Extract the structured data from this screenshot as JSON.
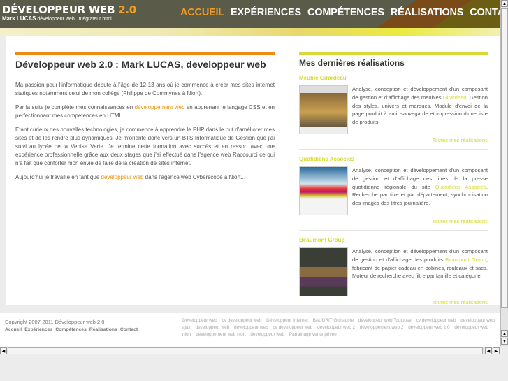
{
  "header": {
    "title": "DÉVELOPPEUR WEB",
    "version": "2.0",
    "author": "Mark LUCAS",
    "tagline": "développeur web, Intégrateur html"
  },
  "nav": [
    {
      "label": "ACCUEIL",
      "active": true
    },
    {
      "label": "EXPÉRIENCES"
    },
    {
      "label": "COMPÉTENCES"
    },
    {
      "label": "RÉALISATIONS"
    },
    {
      "label": "CONTACT"
    }
  ],
  "main": {
    "title": "Développeur web 2.0 : Mark LUCAS, developpeur web",
    "p1": "Ma passion pour l'informatique débute à l'âge de 12-13 ans où je commence à créer mes sites internet statiques notamment celui de mon collège (Philippe de Commynes à Niort).",
    "p2a": "Par la suite je complète mes connaissances en ",
    "p2link": "développement web",
    "p2b": " en apprenant le langage CSS et en perfectionnant mes compétences en HTML.",
    "p3": "Etant curieux des nouvelles technologies, je commence à apprendre le PHP dans le but d'améliorer mes sites et de les rendre plus dynamiques. Je m'oriente donc vers un BTS Informatique de Gestion que j'ai suivi au lycée de la Venise Verte. Je termine cette formation avec succès et en ressort avec une expérience professionnelle grâce aux deux stages que j'ai effectué dans l'agence web Raccourci ce qui n'a fait que conforter mon envie de faire de la création de sites internet.",
    "p4a": "Aujourd'hui je travaille en tant que ",
    "p4link": "développeur web",
    "p4b": " dans l'agence web Cyberscope à Niort..."
  },
  "side": {
    "title": "Mes dernières réalisations",
    "more": "Toutes mes réalisations",
    "items": [
      {
        "name": "Meuble Girardeau",
        "a": "Analyse, conception et développement d'un composant de gestion et d'affichage des meubles ",
        "link": "Girardeau",
        "b": ". Gestion des styles, univers et marques. Module d'envoi de la page produit à ami, sauvegarde et impression d'une liste de produits."
      },
      {
        "name": "Quotidiens Associés",
        "a": "Analyse, conception et développement d'un composant de gestion et d'affichage des titres de la presse quotidienne régionale du site ",
        "link": "Quotidiens Associés",
        "b": ". Recherche par titre et par département, synchronisation des images des titres journalière."
      },
      {
        "name": "Beaumont Group",
        "a": "Analyse, conception et développement d'un composant de gestion et d'affichage des produits ",
        "link": "Beaumont Group",
        "b": ", fabricant de papier cadeau en bobines, rouleaux et sacs. Moteur de recherche avec filtre par famille et catégorie."
      }
    ]
  },
  "footer": {
    "copyright": "Copyright 2007-2011 Développeur web 2.0",
    "links": [
      "Accueil",
      "Expériences",
      "Compétences",
      "Réalisations",
      "Contact"
    ],
    "tags": [
      "Développeur web",
      "cv developpeur web",
      "Développeur Internet",
      "BAUDRIT Guillaume",
      "développeur web Toulouse",
      "cv développeur web",
      "developpeur web ajax",
      "developpeur web",
      "développeur web",
      "cv developpeur web",
      "developpeur web 2",
      "développement web 2",
      "développeur web 2.0",
      "développeur web niort",
      "developpement web niort",
      "developpeur web",
      "Parrainage vente privée"
    ]
  }
}
